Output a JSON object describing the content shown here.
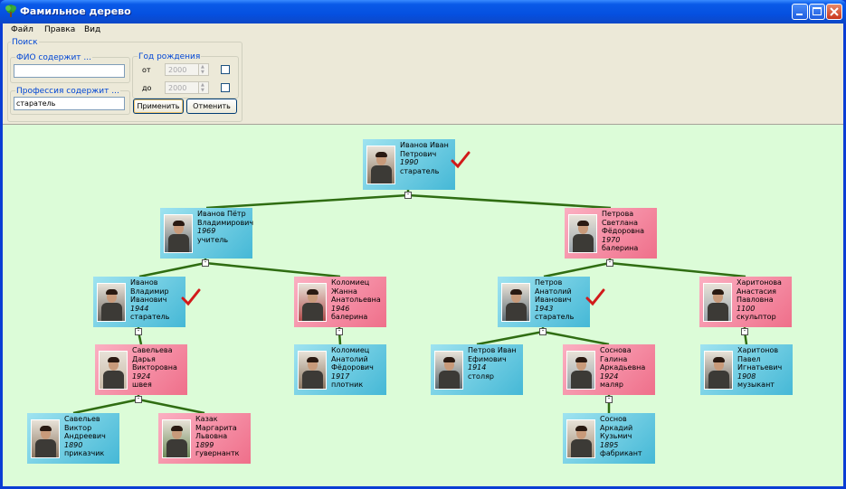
{
  "window": {
    "title": "Фамильное дерево"
  },
  "menu": [
    "Файл",
    "Правка",
    "Вид"
  ],
  "search": {
    "group_label": "Поиск",
    "fio_label": "ФИО содержит ...",
    "fio_value": "",
    "profession_label": "Профессия содержит ...",
    "profession_value": "старатель",
    "birth_label": "Год рождения",
    "from_label": "от",
    "to_label": "до",
    "from_value": "2000",
    "to_value": "2000",
    "from_checked": false,
    "to_checked": false,
    "apply_label": "Применить",
    "cancel_label": "Отменить"
  },
  "colors": {
    "male": "#45b8d6",
    "female": "#ef6f8a",
    "edge": "#2f6d12",
    "canvas": "#dcfcd8",
    "check": "#d11a1a"
  },
  "tree": {
    "collapse_symbol": "-",
    "people": [
      {
        "id": "p1",
        "gender": "m",
        "name": [
          "Иванов Иван",
          "Петрович"
        ],
        "year": "1990",
        "profession": "старатель",
        "match": true
      },
      {
        "id": "p2",
        "gender": "m",
        "name": [
          "Иванов Пётр",
          "Владимирович"
        ],
        "year": "1969",
        "profession": "учитель",
        "match": false
      },
      {
        "id": "p3",
        "gender": "f",
        "name": [
          "Петрова",
          "Светлана",
          "Фёдоровна"
        ],
        "year": "1970",
        "profession": "балерина",
        "match": false
      },
      {
        "id": "p4",
        "gender": "m",
        "name": [
          "Иванов",
          "Владимир",
          "Иванович"
        ],
        "year": "1944",
        "profession": "старатель",
        "match": true
      },
      {
        "id": "p5",
        "gender": "f",
        "name": [
          "Коломиец",
          "Жанна",
          "Анатольевна"
        ],
        "year": "1946",
        "profession": "балерина",
        "match": false
      },
      {
        "id": "p6",
        "gender": "m",
        "name": [
          "Петров",
          "Анатолий",
          "Иванович"
        ],
        "year": "1943",
        "profession": "старатель",
        "match": true
      },
      {
        "id": "p7",
        "gender": "f",
        "name": [
          "Харитонова",
          "Анастасия",
          "Павловна"
        ],
        "year": "1100",
        "profession": "скульптор",
        "match": false
      },
      {
        "id": "p8",
        "gender": "f",
        "name": [
          "Савельева",
          "Дарья",
          "Викторовна"
        ],
        "year": "1924",
        "profession": "швея",
        "match": false
      },
      {
        "id": "p9",
        "gender": "m",
        "name": [
          "Коломиец",
          "Анатолий",
          "Фёдорович"
        ],
        "year": "1917",
        "profession": "плотник",
        "match": false
      },
      {
        "id": "p10",
        "gender": "m",
        "name": [
          "Петров Иван",
          "Ефимович"
        ],
        "year": "1914",
        "profession": "столяр",
        "match": false
      },
      {
        "id": "p11",
        "gender": "f",
        "name": [
          "Соснова",
          "Галина",
          "Аркадьевна"
        ],
        "year": "1924",
        "profession": "маляр",
        "match": false
      },
      {
        "id": "p12",
        "gender": "m",
        "name": [
          "Харитонов",
          "Павел",
          "Игнатьевич"
        ],
        "year": "1908",
        "profession": "музыкант",
        "match": false
      },
      {
        "id": "p13",
        "gender": "m",
        "name": [
          "Савельев",
          "Виктор",
          "Андреевич"
        ],
        "year": "1890",
        "profession": "приказчик",
        "match": false
      },
      {
        "id": "p14",
        "gender": "f",
        "name": [
          "Казак",
          "Маргарита",
          "Львовна"
        ],
        "year": "1899",
        "profession": "гувернантк",
        "match": false
      },
      {
        "id": "p15",
        "gender": "m",
        "name": [
          "Соснов",
          "Аркадий",
          "Кузьмич"
        ],
        "year": "1895",
        "profession": "фабрикант",
        "match": false
      }
    ]
  }
}
